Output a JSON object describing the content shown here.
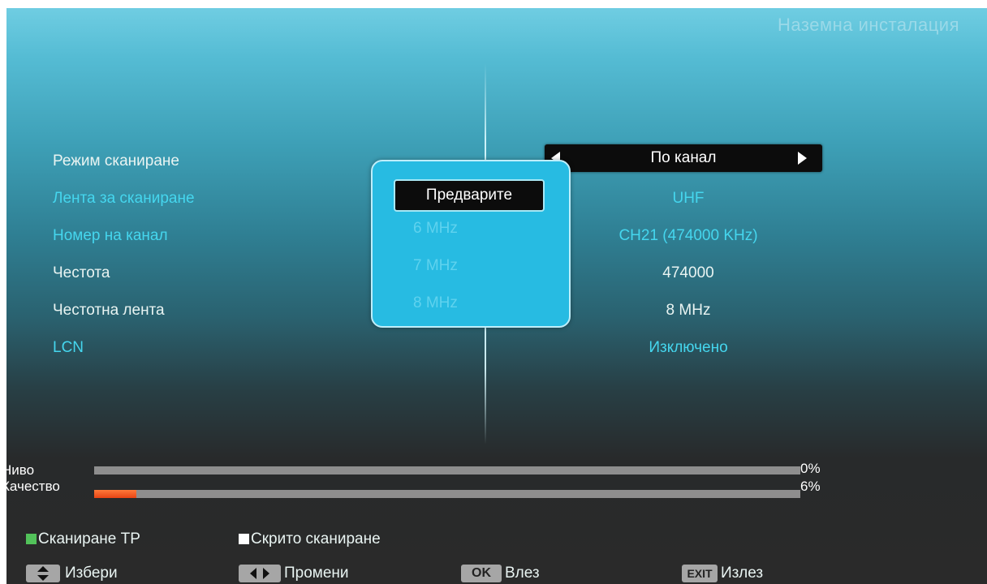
{
  "header": {
    "title": "Наземна инсталация"
  },
  "settings": [
    {
      "label": "Режим сканиране",
      "value": "По канал"
    },
    {
      "label": "Лента за сканиране",
      "value": "UHF"
    },
    {
      "label": "Номер на канал",
      "value": "CH21 (474000 KHz)"
    },
    {
      "label": "Честота",
      "value": "474000"
    },
    {
      "label": "Честотна лента",
      "value": "8 MHz"
    },
    {
      "label": "LCN",
      "value": "Изключено"
    }
  ],
  "popup": {
    "selected": "Предварите",
    "options": [
      "6 MHz",
      "7 MHz",
      "8 MHz"
    ]
  },
  "signal": {
    "level": {
      "label": "Ниво",
      "percent_text": "0%",
      "value": 0
    },
    "quality": {
      "label": "Качество",
      "percent_text": "6%",
      "value": 6
    }
  },
  "colors": {
    "accent_cyan": "#45d6ee",
    "quality_fill": "#e84414",
    "green_key": "#52c25a",
    "white_key": "#ffffff"
  },
  "legend": {
    "scan_tp": "Сканиране TP",
    "hidden_scan": "Скрито сканиране",
    "select": "Избери",
    "change": "Промени",
    "ok_key": "OK",
    "enter": "Влез",
    "exit_key": "EXIT",
    "exit": "Излез"
  }
}
